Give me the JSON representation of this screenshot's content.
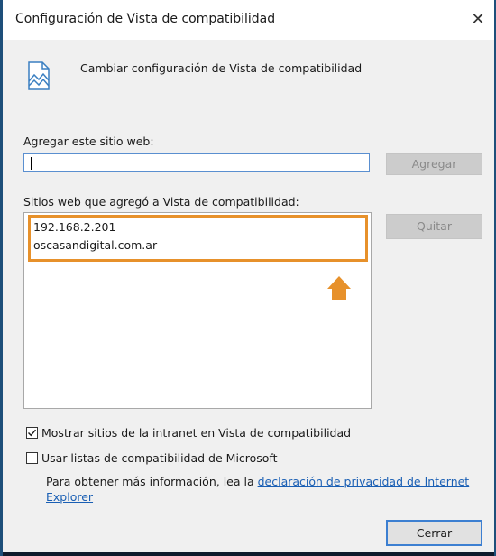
{
  "window": {
    "title": "Configuración de Vista de compatibilidad",
    "close_glyph": "✕"
  },
  "header": {
    "icon": "compatibility-settings-icon",
    "text": "Cambiar configuración de Vista de compatibilidad"
  },
  "add_site": {
    "label": "Agregar este sitio web:",
    "input_value": "",
    "add_button": "Agregar"
  },
  "sites_list": {
    "label": "Sitios web que agregó a Vista de compatibilidad:",
    "items": [
      "192.168.2.201",
      "oscasandigital.com.ar"
    ],
    "remove_button": "Quitar"
  },
  "options": {
    "intranet": {
      "label": "Mostrar sitios de la intranet en Vista de compatibilidad",
      "checked": true
    },
    "microsoft_lists": {
      "label": "Usar listas de compatibilidad de Microsoft",
      "checked": false
    }
  },
  "info": {
    "prefix": "Para obtener más información, lea la ",
    "link_line1": "declaración de privacidad de Internet",
    "link_line2": "Explorer"
  },
  "footer": {
    "close_button": "Cerrar"
  },
  "colors": {
    "highlight": "#e7912b",
    "link": "#1a5fb4",
    "focus_border": "#5a8fd0"
  }
}
